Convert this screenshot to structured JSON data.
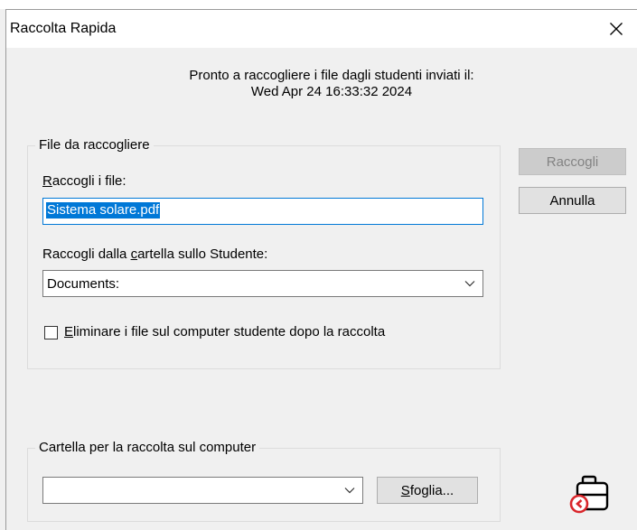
{
  "window": {
    "title": "Raccolta Rapida",
    "close_symbol": "✕"
  },
  "info": {
    "line1": "Pronto a raccogliere i file dagli studenti inviati il:",
    "line2": "Wed Apr 24 16:33:32 2024"
  },
  "files_group": {
    "legend": "File da raccogliere",
    "collect_label_accel": "R",
    "collect_label_rest": "accogli i file:",
    "file_value": "Sistema solare.pdf",
    "folder_label_pre": "Raccogli dalla ",
    "folder_label_accel": "c",
    "folder_label_post": "artella sullo Studente:",
    "folder_value": "Documents:",
    "delete_label_accel": "E",
    "delete_label_rest": "liminare i file sul computer studente dopo la raccolta",
    "delete_checked": false
  },
  "buttons": {
    "collect": "Raccogli",
    "cancel": "Annulla"
  },
  "computer_group": {
    "legend": "Cartella per la raccolta sul computer",
    "folder_value": "",
    "browse_accel": "S",
    "browse_rest": "foglia..."
  },
  "icons": {
    "close": "close-icon",
    "dropdown": "chevron-down-icon",
    "collect_tool": "briefcase-collect-icon"
  },
  "colors": {
    "accent": "#0078d7",
    "icon_red": "#d9262b"
  }
}
